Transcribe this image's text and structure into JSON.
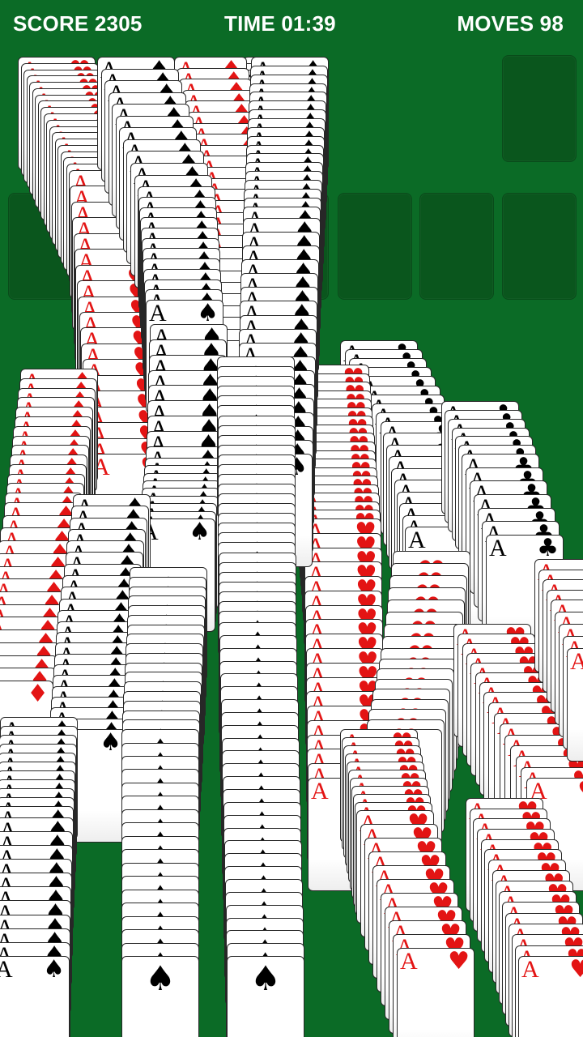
{
  "hud": {
    "score": "SCORE 2305",
    "time": "TIME 01:39",
    "moves": "MOVES 98"
  },
  "slots": {
    "foundations": 4,
    "tableau_placeholders": 4
  },
  "colors": {
    "felt": "#0b6b26",
    "slot": "#0a561d",
    "red_suit": "#e31414",
    "black_suit": "#000000",
    "hud_text": "#ffffff"
  },
  "cascade": {
    "card_rank": "A",
    "suits": {
      "hearts": "♥",
      "diamonds": "♦",
      "clubs": "♣",
      "spades": "♠"
    }
  }
}
